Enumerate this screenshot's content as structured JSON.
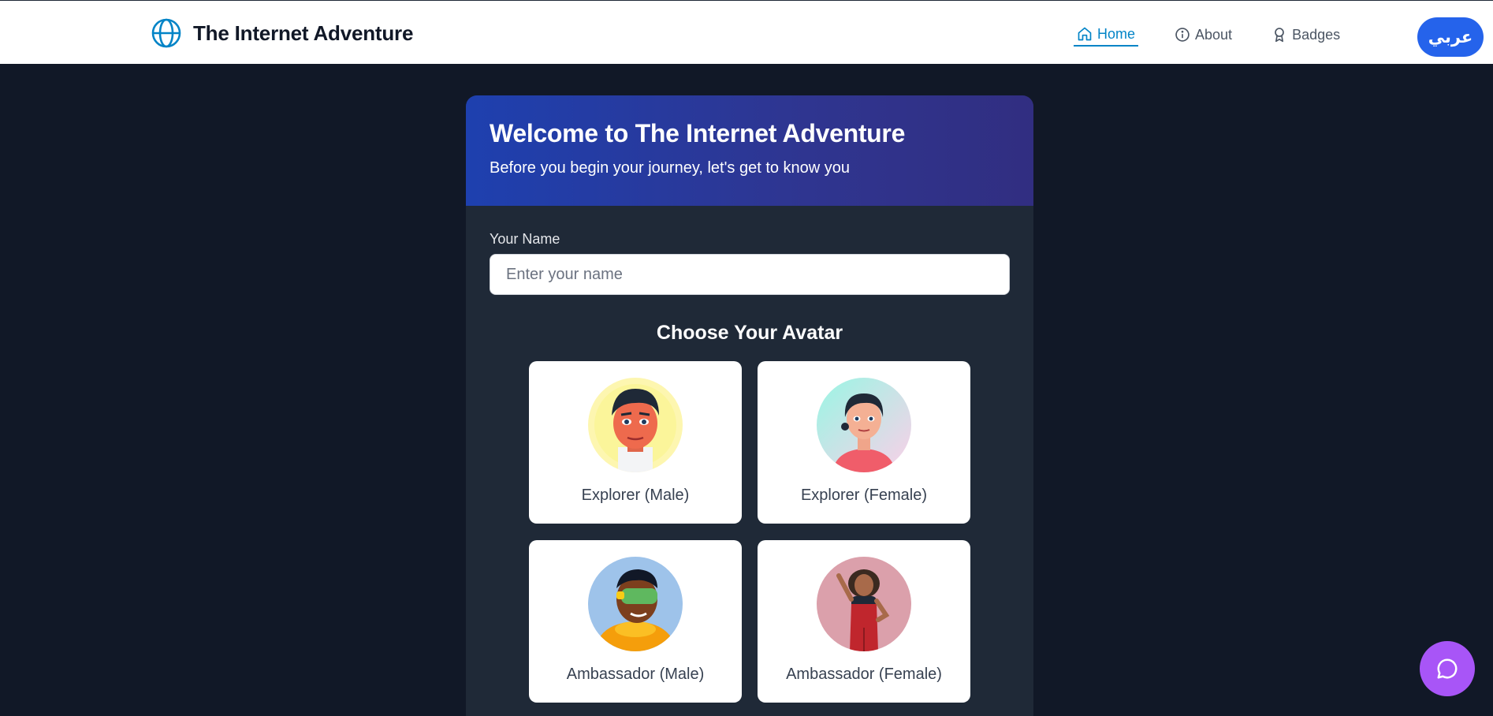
{
  "brand": {
    "title": "The Internet Adventure",
    "icon": "globe-icon"
  },
  "nav": {
    "items": [
      {
        "label": "Home",
        "icon": "home-icon",
        "active": true
      },
      {
        "label": "About",
        "icon": "info-icon",
        "active": false
      },
      {
        "label": "Badges",
        "icon": "award-icon",
        "active": false
      }
    ],
    "language_button": "عربي"
  },
  "welcome": {
    "title": "Welcome to The Internet Adventure",
    "subtitle": "Before you begin your journey, let's get to know you"
  },
  "form": {
    "name_label": "Your Name",
    "name_placeholder": "Enter your name",
    "name_value": ""
  },
  "avatars": {
    "title": "Choose Your Avatar",
    "options": [
      {
        "label": "Explorer (Male)",
        "icon": "explorer-male-avatar"
      },
      {
        "label": "Explorer (Female)",
        "icon": "explorer-female-avatar"
      },
      {
        "label": "Ambassador (Male)",
        "icon": "ambassador-male-avatar"
      },
      {
        "label": "Ambassador (Female)",
        "icon": "ambassador-female-avatar"
      }
    ]
  },
  "chat": {
    "icon": "chat-bubble-icon"
  },
  "colors": {
    "primary_blue": "#2563eb",
    "link_active": "#0284c7",
    "page_bg": "#111827",
    "card_bg": "#1f2937",
    "chat_purple": "#a855f7"
  }
}
